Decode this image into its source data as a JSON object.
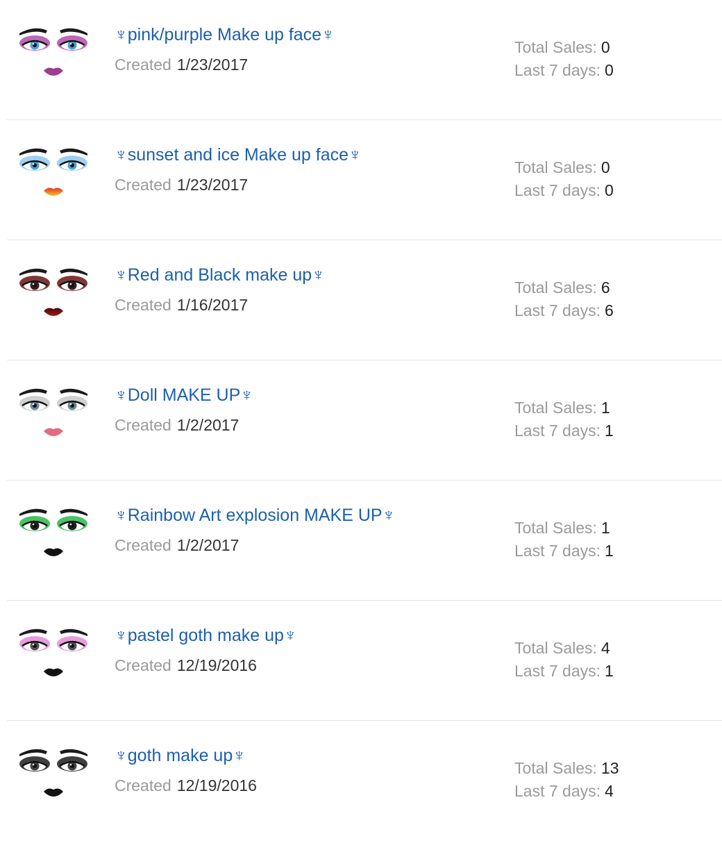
{
  "items": [
    {
      "title": "♆pink/purple Make up face♆",
      "created_label": "Created",
      "created": "1/23/2017",
      "total_label": "Total Sales:",
      "total": "0",
      "last7_label": "Last 7 days:",
      "last7": "0",
      "colors": {
        "shadow": "#b04fa8",
        "iris": "#4aa3d8",
        "lips": "#9b3f8c",
        "lips2": "#9b3f8c"
      }
    },
    {
      "title": "♆sunset and ice Make up face♆",
      "created_label": "Created",
      "created": "1/23/2017",
      "total_label": "Total Sales:",
      "total": "0",
      "last7_label": "Last 7 days:",
      "last7": "0",
      "colors": {
        "shadow": "#8ec8ef",
        "iris": "#4aa3d8",
        "lips": "#e23b1f",
        "lips2": "#f0c030"
      }
    },
    {
      "title": "♆Red and Black make up♆",
      "created_label": "Created",
      "created": "1/16/2017",
      "total_label": "Total Sales:",
      "total": "6",
      "last7_label": "Last 7 days:",
      "last7": "6",
      "colors": {
        "shadow": "#6b1414",
        "iris": "#3a2020",
        "lips": "#4a0a0a",
        "lips2": "#a01a1a"
      }
    },
    {
      "title": "♆Doll MAKE UP♆",
      "created_label": "Created",
      "created": "1/2/2017",
      "total_label": "Total Sales:",
      "total": "1",
      "last7_label": "Last 7 days:",
      "last7": "1",
      "colors": {
        "shadow": "#c8c8c8",
        "iris": "#6a8a9a",
        "lips": "#e56b80",
        "lips2": "#e56b80"
      }
    },
    {
      "title": "♆Rainbow Art explosion MAKE UP♆",
      "created_label": "Created",
      "created": "1/2/2017",
      "total_label": "Total Sales:",
      "total": "1",
      "last7_label": "Last 7 days:",
      "last7": "1",
      "colors": {
        "shadow": "#27b84a",
        "iris": "#222222",
        "lips": "#111111",
        "lips2": "#111111"
      }
    },
    {
      "title": "♆pastel goth make up♆",
      "created_label": "Created",
      "created": "12/19/2016",
      "total_label": "Total Sales:",
      "total": "4",
      "last7_label": "Last 7 days:",
      "last7": "1",
      "colors": {
        "shadow": "#e48bd5",
        "iris": "#555555",
        "lips": "#111111",
        "lips2": "#111111"
      }
    },
    {
      "title": "♆goth make up♆",
      "created_label": "Created",
      "created": "12/19/2016",
      "total_label": "Total Sales:",
      "total": "13",
      "last7_label": "Last 7 days:",
      "last7": "4",
      "colors": {
        "shadow": "#1e1e1e",
        "iris": "#444444",
        "lips": "#111111",
        "lips2": "#111111"
      }
    }
  ]
}
